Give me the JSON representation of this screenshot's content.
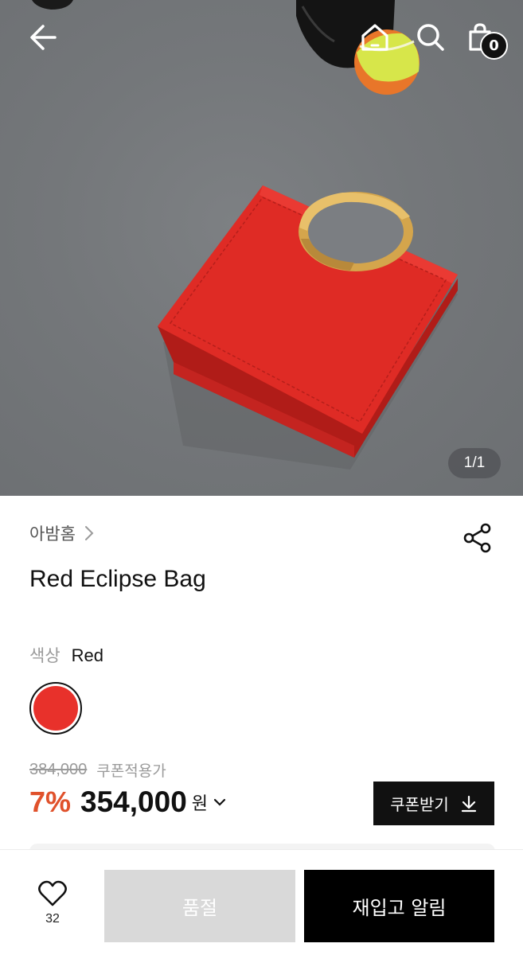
{
  "header": {
    "cart_count": "0",
    "image_counter": "1/1"
  },
  "product": {
    "brand": "아밤홈",
    "title": "Red Eclipse Bag",
    "color_label": "색상",
    "color_value": "Red",
    "swatch_color": "#e8312b"
  },
  "pricing": {
    "original_price": "384,000",
    "coupon_note": "쿠폰적용가",
    "discount": "7%",
    "price": "354,000",
    "currency": "원",
    "coupon_button": "쿠폰받기",
    "discount_color": "#e0512b"
  },
  "bottom_bar": {
    "like_count": "32",
    "soldout_label": "품절",
    "restock_label": "재입고 알림"
  },
  "icons": [
    "back-arrow-icon",
    "home-icon",
    "search-icon",
    "shopping-bag-icon",
    "chevron-right-icon",
    "share-icon",
    "chevron-down-icon",
    "download-icon",
    "heart-icon"
  ]
}
